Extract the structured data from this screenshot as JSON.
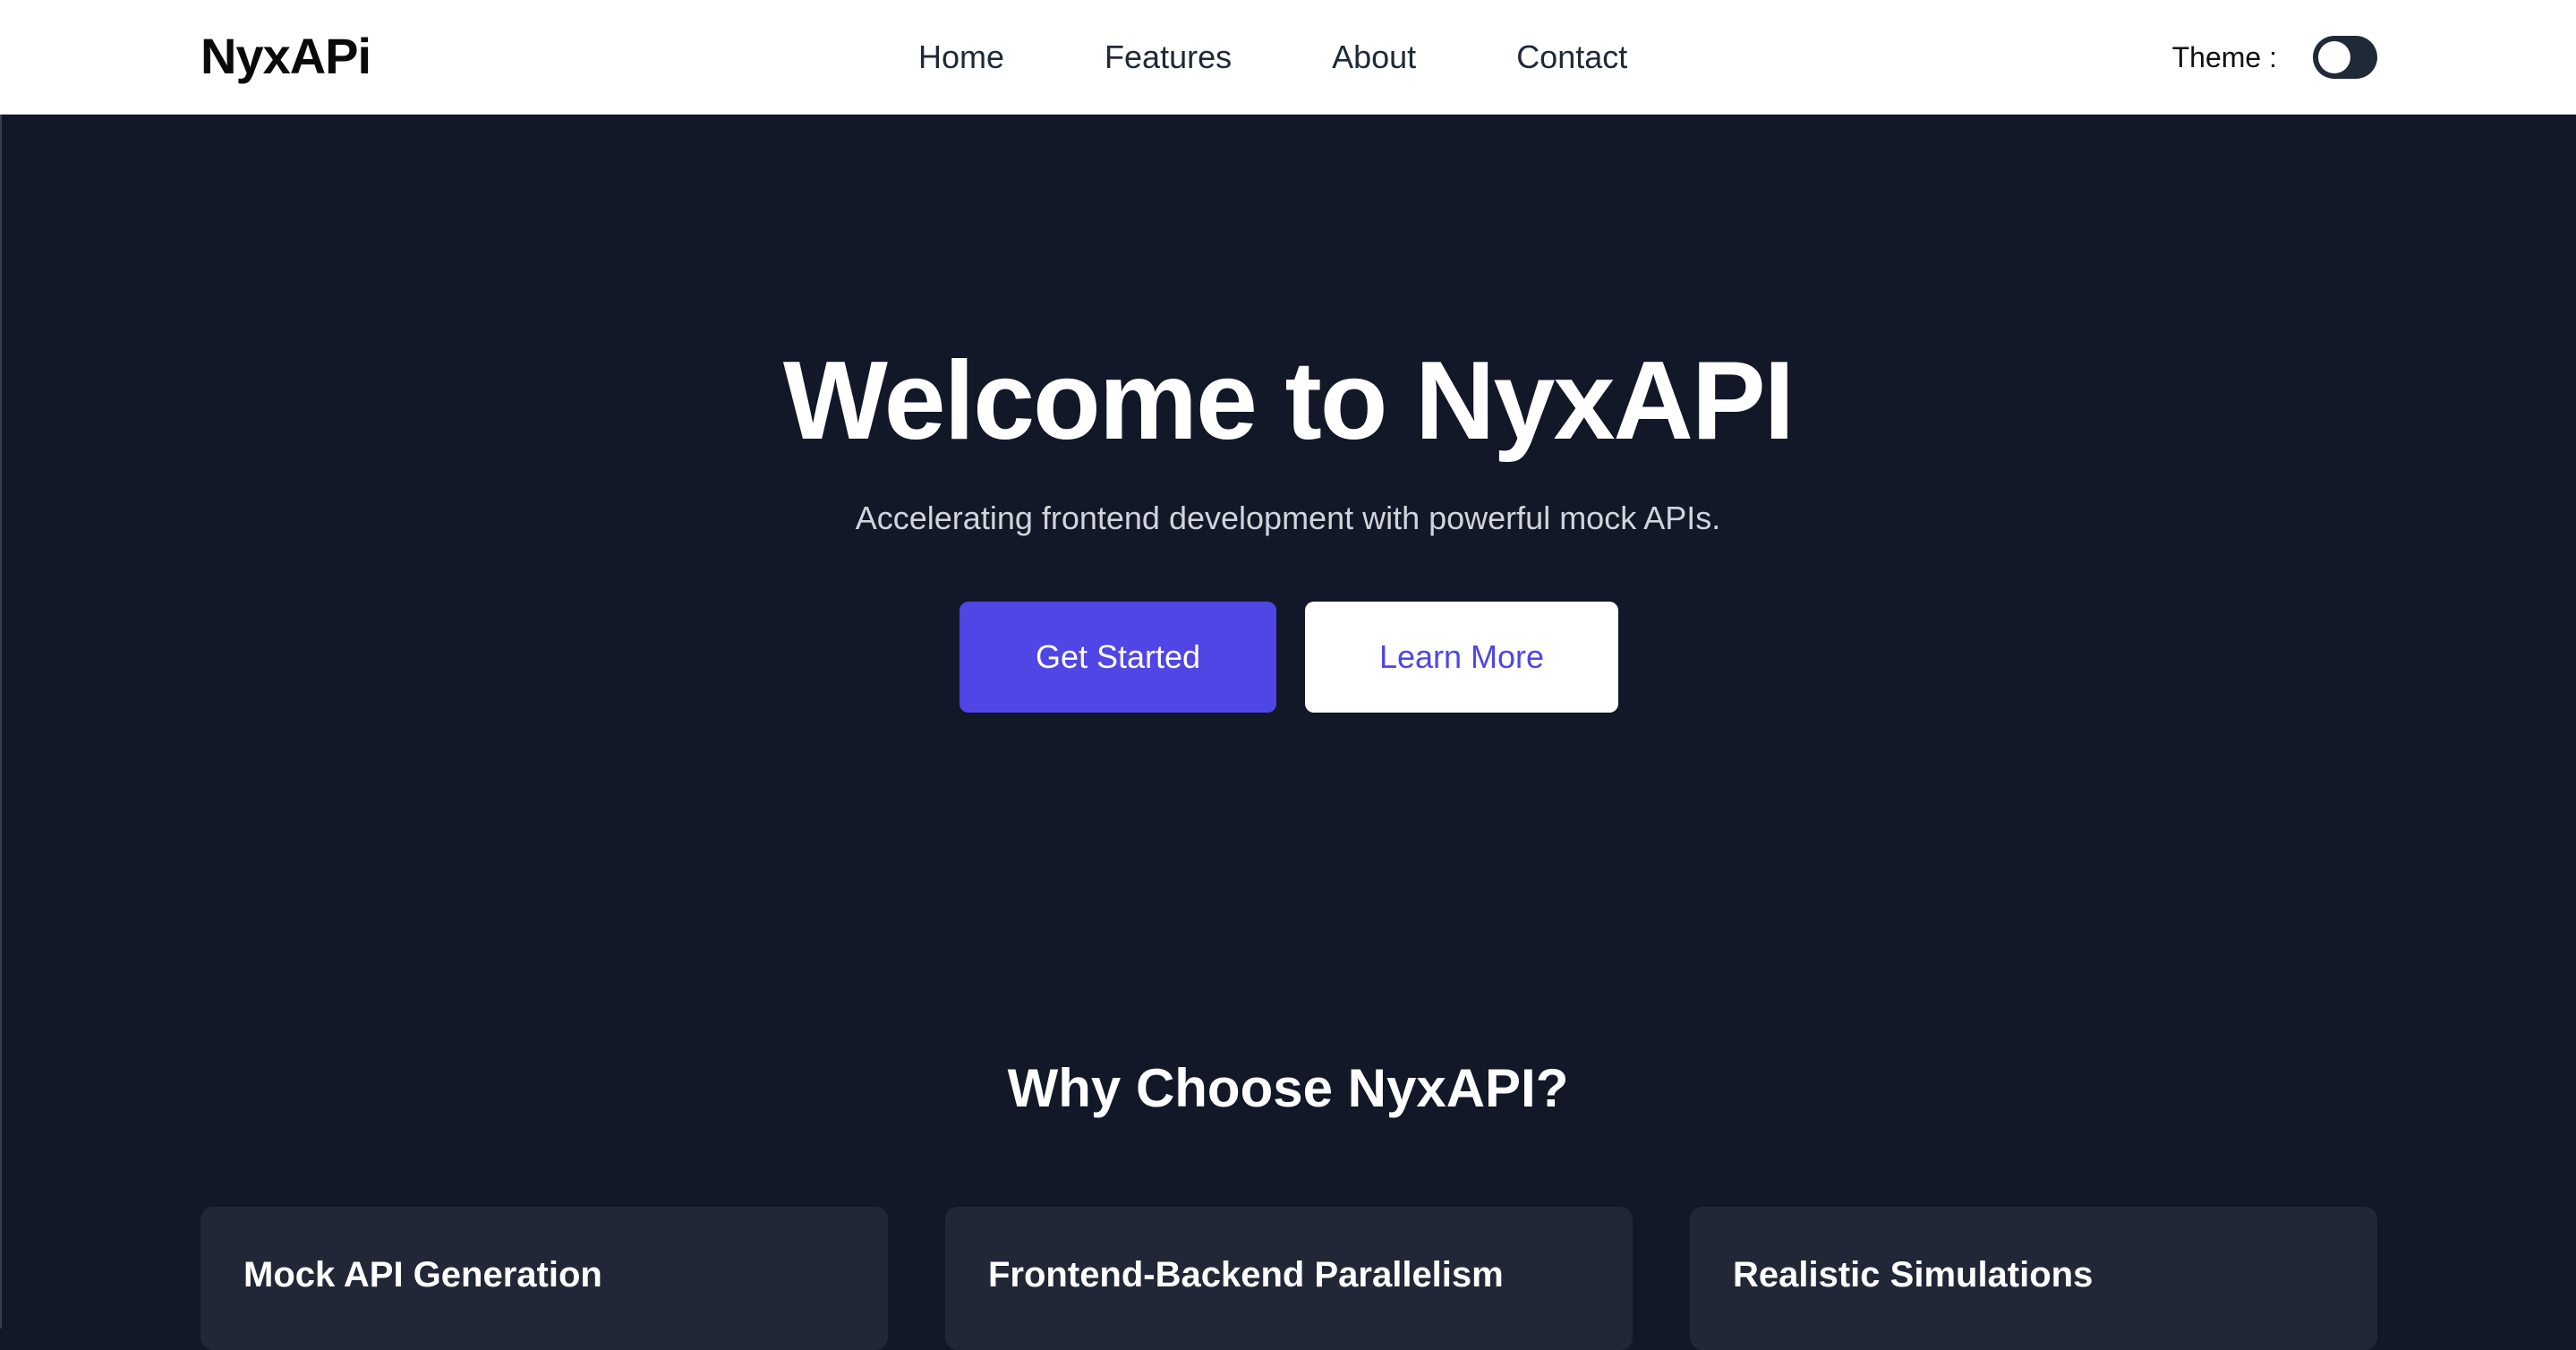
{
  "navbar": {
    "logo": "NyxAPi",
    "links": [
      "Home",
      "Features",
      "About",
      "Contact"
    ],
    "theme_label": "Theme :"
  },
  "hero": {
    "title": "Welcome to NyxAPI",
    "subtitle": "Accelerating frontend development with powerful mock APIs.",
    "primary_button": "Get Started",
    "secondary_button": "Learn More"
  },
  "features": {
    "title": "Why Choose NyxAPI?",
    "cards": [
      {
        "title": "Mock API Generation"
      },
      {
        "title": "Frontend-Backend Parallelism"
      },
      {
        "title": "Realistic Simulations"
      }
    ]
  },
  "colors": {
    "background": "#121828",
    "navbar_bg": "#ffffff",
    "accent": "#4f46e5",
    "card_bg": "#212736"
  },
  "icons": {
    "theme_toggle": "toggle-switch-icon"
  }
}
